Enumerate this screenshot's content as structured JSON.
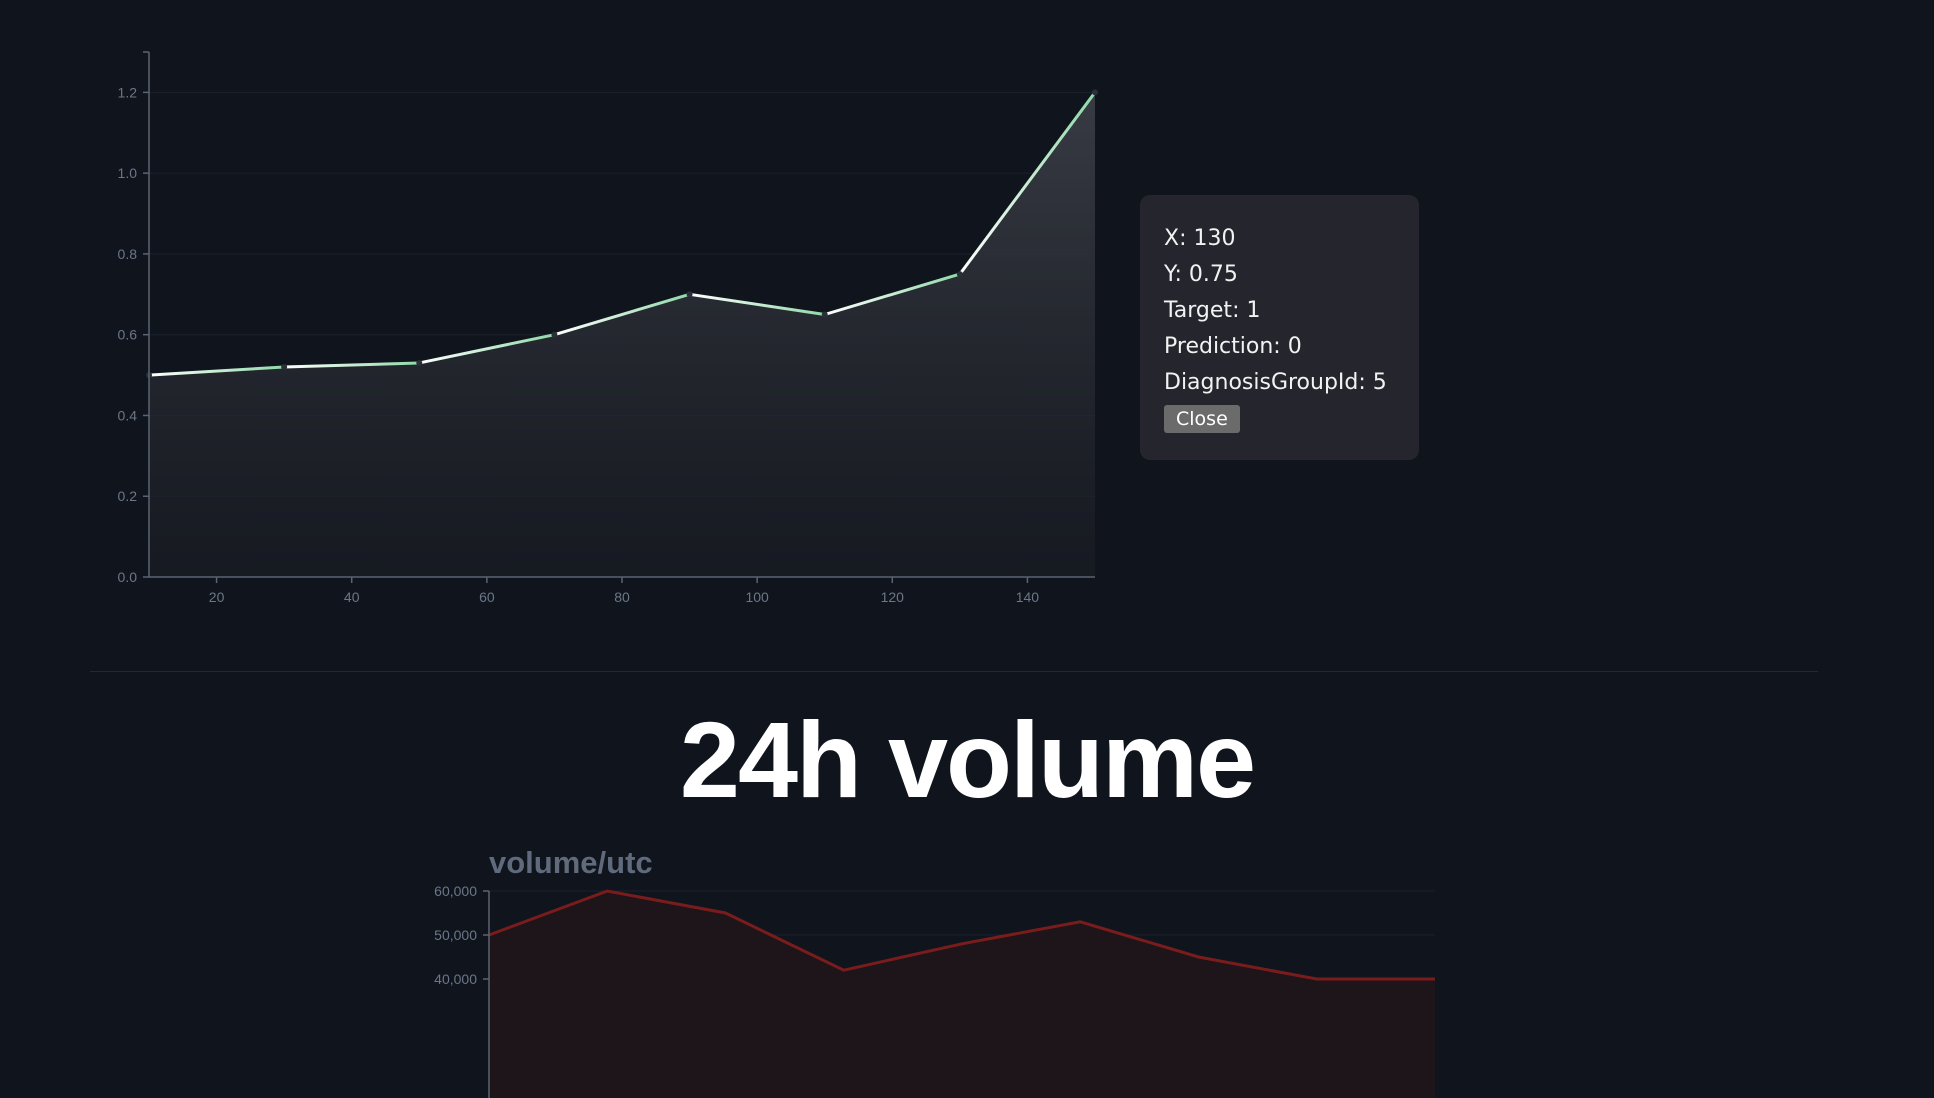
{
  "tooltip": {
    "x_label": "X: ",
    "x_value": "130",
    "y_label": "Y: ",
    "y_value": "0.75",
    "target_label": "Target: ",
    "target_value": "1",
    "prediction_label": "Prediction: ",
    "prediction_value": "0",
    "group_label": "DiagnosisGroupId: ",
    "group_value": "5",
    "close_label": "Close"
  },
  "headline": "24h volume",
  "colors": {
    "background": "#10141c",
    "line1": "#8fd9a8",
    "line2": "#7a1c1c"
  },
  "chart_data": [
    {
      "type": "area",
      "x": [
        10,
        30,
        50,
        70,
        90,
        110,
        130,
        150
      ],
      "y": [
        0.5,
        0.52,
        0.53,
        0.6,
        0.7,
        0.65,
        0.75,
        1.2
      ],
      "xticks": [
        "20",
        "40",
        "60",
        "80",
        "100",
        "120",
        "140"
      ],
      "yticks": [
        "0.0",
        "0.2",
        "0.4",
        "0.6",
        "0.8",
        "1.0",
        "1.2"
      ],
      "xlim": [
        10,
        150
      ],
      "ylim": [
        0,
        1.3
      ],
      "grid": true,
      "selected_x": 130
    },
    {
      "type": "area",
      "title": "volume/utc",
      "y": [
        50000,
        60000,
        55000,
        42000,
        48000,
        53000,
        45000,
        40000,
        40000
      ],
      "yticks": [
        "60,000",
        "50,000",
        "40,000"
      ],
      "ylim": [
        40000,
        60000
      ],
      "grid": true
    }
  ]
}
